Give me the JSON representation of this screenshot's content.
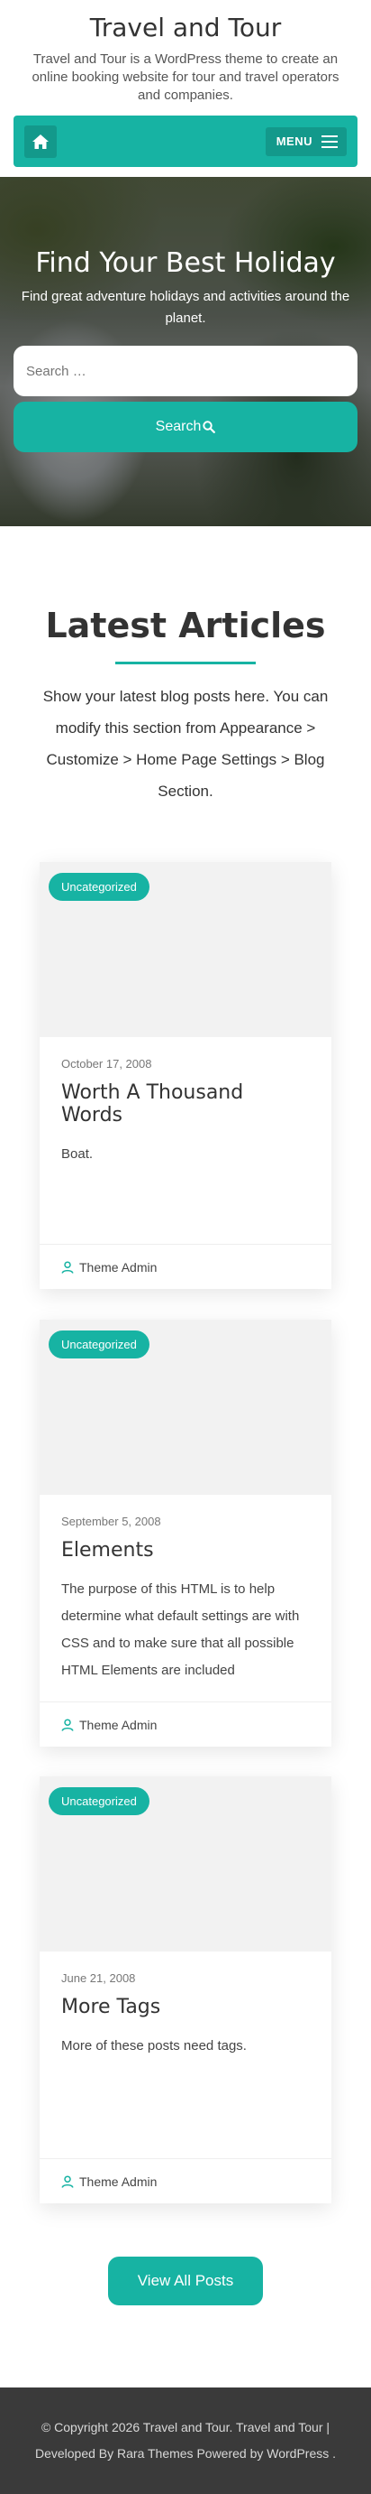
{
  "site": {
    "title": "Travel and Tour",
    "description": "Travel and Tour is a WordPress theme to create an online booking website for tour and travel operators and companies."
  },
  "nav": {
    "home_icon": "home-icon",
    "menu_label": "MENU",
    "menu_icon": "hamburger-icon"
  },
  "banner": {
    "title": "Find Your Best Holiday",
    "subtitle": "Find great adventure holidays and activities around the planet.",
    "search_placeholder": "Search …",
    "search_button": "Search",
    "search_icon": "search-icon"
  },
  "articles": {
    "title": "Latest Articles",
    "description": "Show your latest blog posts here. You can modify this section from Appearance > Customize > Home Page Settings > Blog Section.",
    "posts": [
      {
        "category": "Uncategorized",
        "date": "October 17, 2008",
        "title": "Worth A Thousand Words",
        "excerpt": "Boat.",
        "author": "Theme Admin"
      },
      {
        "category": "Uncategorized",
        "date": "September 5, 2008",
        "title": "Elements",
        "excerpt": "The purpose of this HTML is to help determine what default settings are with CSS and to make sure that all possible HTML Elements are included",
        "author": "Theme Admin"
      },
      {
        "category": "Uncategorized",
        "date": "June 21, 2008",
        "title": "More Tags",
        "excerpt": "More of these posts need tags.",
        "author": "Theme Admin"
      }
    ],
    "view_all": "View All Posts"
  },
  "footer": {
    "line1": "© Copyright 2026 Travel and Tour. Travel and Tour |",
    "line2": "Developed By Rara Themes Powered by WordPress ."
  },
  "colors": {
    "accent": "#17b3a3",
    "accent_dark": "#13998b",
    "footer_bg": "#3a3a3a"
  }
}
